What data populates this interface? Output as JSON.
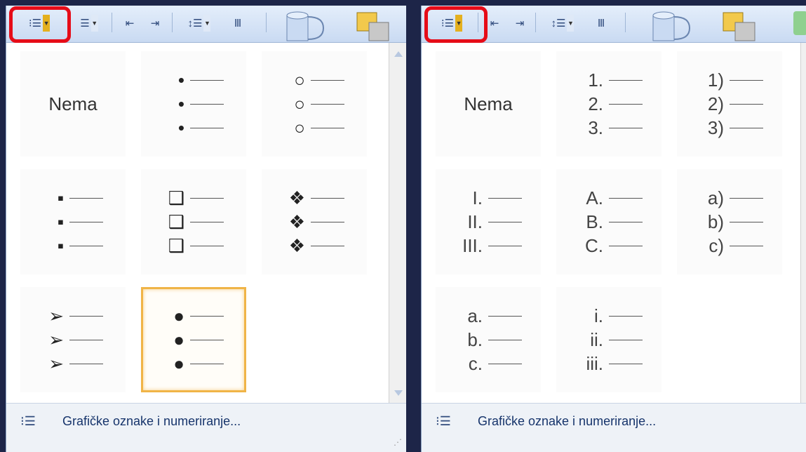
{
  "left": {
    "none_label": "Nema",
    "bullet_styles": [
      {
        "name": "bullet-small-dot",
        "marker": "•"
      },
      {
        "name": "bullet-hollow-circle",
        "marker": "○"
      },
      {
        "name": "bullet-square",
        "marker": "▪"
      },
      {
        "name": "bullet-hollow-square",
        "marker": "❑"
      },
      {
        "name": "bullet-four-diamond",
        "marker": "❖"
      },
      {
        "name": "bullet-arrow",
        "marker": "➢"
      },
      {
        "name": "bullet-large-dot",
        "marker": "●"
      }
    ],
    "footer_label": "Grafičke oznake i numeriranje..."
  },
  "right": {
    "none_label": "Nema",
    "numbering_styles": [
      {
        "name": "numbering-arabic-dot",
        "markers": [
          "1.",
          "2.",
          "3."
        ]
      },
      {
        "name": "numbering-arabic-paren",
        "markers": [
          "1)",
          "2)",
          "3)"
        ]
      },
      {
        "name": "numbering-roman-upper",
        "markers": [
          "I.",
          "II.",
          "III."
        ]
      },
      {
        "name": "numbering-alpha-upper",
        "markers": [
          "A.",
          "B.",
          "C."
        ]
      },
      {
        "name": "numbering-alpha-lower-paren",
        "markers": [
          "a)",
          "b)",
          "c)"
        ]
      },
      {
        "name": "numbering-alpha-lower-dot",
        "markers": [
          "a.",
          "b.",
          "c."
        ]
      },
      {
        "name": "numbering-roman-lower",
        "markers": [
          "i.",
          "ii.",
          "iii."
        ]
      }
    ],
    "footer_label": "Grafičke oznake i numeriranje..."
  },
  "icons": {
    "bullets": "bullets-list-icon",
    "numbering": "numbered-list-icon",
    "multilevel": "multilevel-list-icon",
    "decrease_indent": "decrease-indent-icon",
    "increase_indent": "increase-indent-icon",
    "line_spacing": "line-spacing-icon",
    "text_direction": "text-direction-icon",
    "dropdown": "dropdown-arrow-icon"
  },
  "colors": {
    "highlight": "#e60c18",
    "selected_border": "#f0b447",
    "accent": "#2f4a7c"
  }
}
